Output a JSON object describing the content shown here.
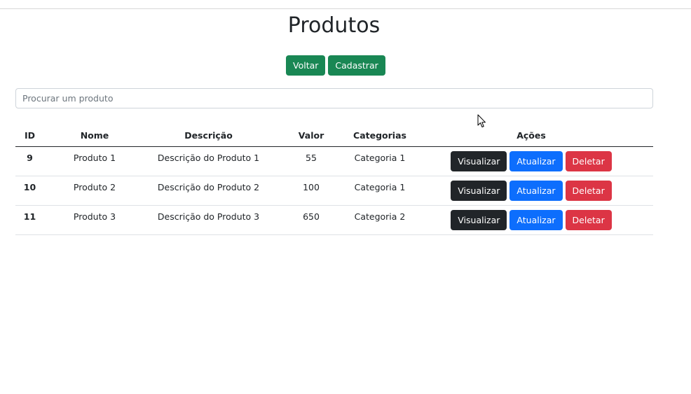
{
  "page": {
    "title": "Produtos"
  },
  "toolbar": {
    "back_label": "Voltar",
    "create_label": "Cadastrar"
  },
  "search": {
    "placeholder": "Procurar um produto",
    "value": ""
  },
  "table": {
    "headers": {
      "id": "ID",
      "name": "Nome",
      "description": "Descrição",
      "value": "Valor",
      "categories": "Categorias",
      "actions": "Ações"
    },
    "rows": [
      {
        "id": "9",
        "name": "Produto 1",
        "description": "Descrição do Produto 1",
        "value": "55",
        "category": "Categoria 1"
      },
      {
        "id": "10",
        "name": "Produto 2",
        "description": "Descrição do Produto 2",
        "value": "100",
        "category": "Categoria 1"
      },
      {
        "id": "11",
        "name": "Produto 3",
        "description": "Descrição do Produto 3",
        "value": "650",
        "category": "Categoria 2"
      }
    ],
    "row_actions": {
      "view_label": "Visualizar",
      "update_label": "Atualizar",
      "delete_label": "Deletar"
    }
  },
  "colors": {
    "success": "#198754",
    "dark": "#212529",
    "primary": "#0d6efd",
    "danger": "#dc3545"
  },
  "icons": {
    "cursor": "mouse-pointer-icon"
  }
}
